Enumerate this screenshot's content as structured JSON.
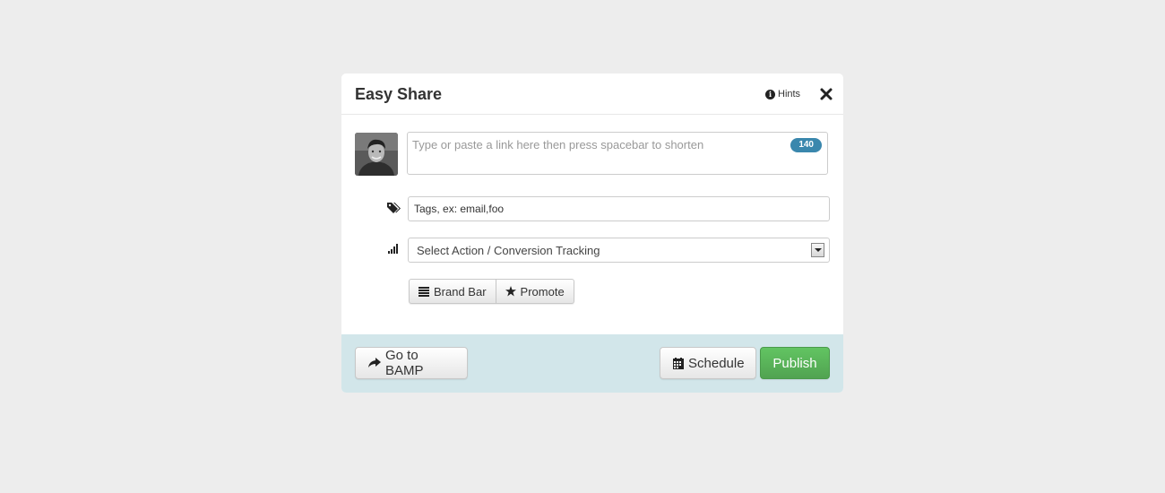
{
  "modal": {
    "title": "Easy Share",
    "hints_label": "Hints",
    "close_icon": "close-icon"
  },
  "composer": {
    "avatar": "user-avatar",
    "link_placeholder": "Type or paste a link here then press spacebar to shorten",
    "link_value": "",
    "char_count": "140"
  },
  "tags": {
    "icon": "tags-icon",
    "placeholder": "Tags, ex: email,foo",
    "value": ""
  },
  "tracking": {
    "icon": "signal-bars-icon",
    "selected": "Select Action / Conversion Tracking"
  },
  "options": {
    "brand_bar_label": "Brand Bar",
    "brand_bar_icon": "list-icon",
    "promote_label": "Promote",
    "promote_icon": "star-icon"
  },
  "footer": {
    "bamp_label": "Go to BAMP",
    "bamp_icon": "share-arrow-icon",
    "schedule_label": "Schedule",
    "schedule_icon": "calendar-icon",
    "publish_label": "Publish"
  },
  "colors": {
    "page_bg": "#ededed",
    "footer_bg": "#d2e6ea",
    "badge": "#3a87ad",
    "publish": "#51a351"
  }
}
